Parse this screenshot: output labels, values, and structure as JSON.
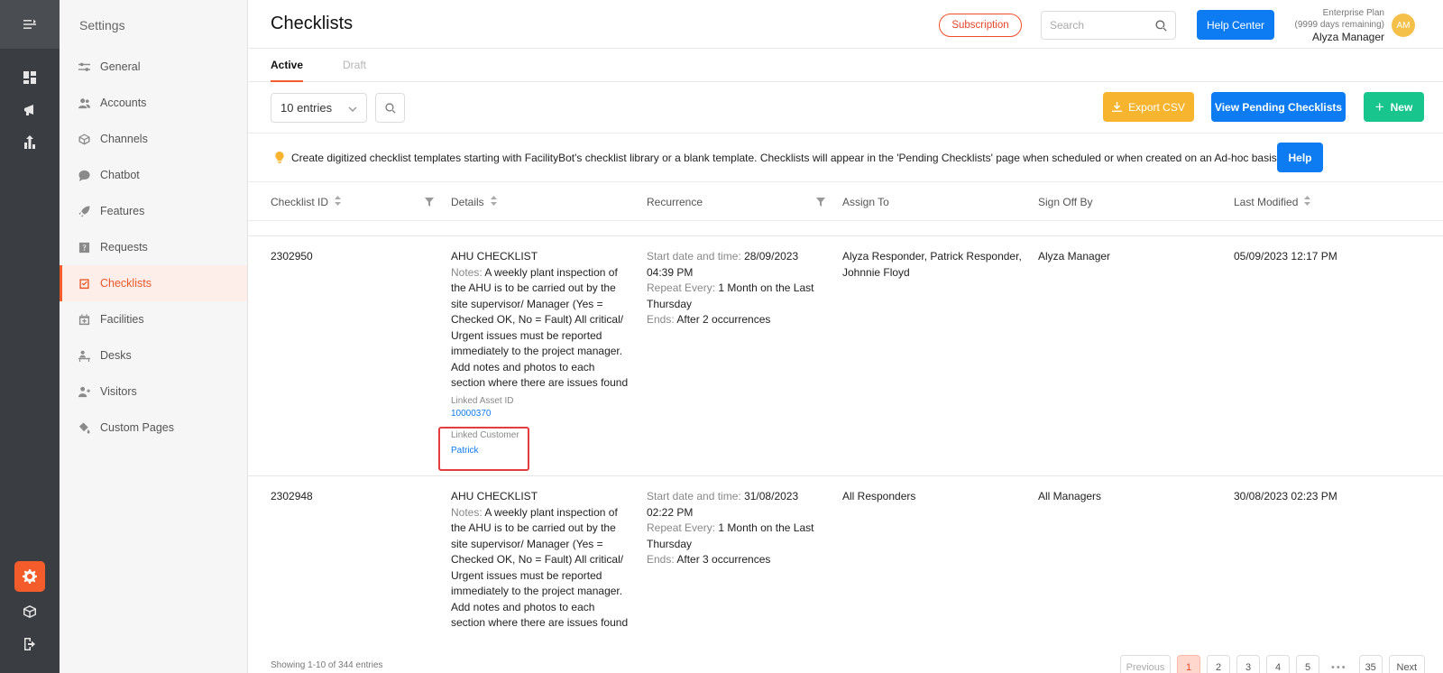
{
  "colors": {
    "accent": "#f45d2b",
    "primary": "#0d7cf2",
    "warning": "#f7b52f",
    "success": "#17c58d",
    "highlight": "#e33d3d"
  },
  "sidebar": {
    "title": "Settings",
    "items": [
      {
        "label": "General",
        "icon": "sliders-icon"
      },
      {
        "label": "Accounts",
        "icon": "users-icon"
      },
      {
        "label": "Channels",
        "icon": "cube-icon"
      },
      {
        "label": "Chatbot",
        "icon": "chat-icon"
      },
      {
        "label": "Features",
        "icon": "rocket-icon"
      },
      {
        "label": "Requests",
        "icon": "question-icon"
      },
      {
        "label": "Checklists",
        "icon": "checklist-icon"
      },
      {
        "label": "Facilities",
        "icon": "calendar-icon"
      },
      {
        "label": "Desks",
        "icon": "desk-icon"
      },
      {
        "label": "Visitors",
        "icon": "visitor-icon"
      },
      {
        "label": "Custom Pages",
        "icon": "paint-icon"
      }
    ]
  },
  "header": {
    "title": "Checklists",
    "subscription": "Subscription",
    "search_placeholder": "Search",
    "help_center": "Help Center",
    "plan_name": "Enterprise Plan",
    "plan_days": "(9999 days remaining)",
    "user_name": "Alyza Manager",
    "avatar_initials": "AM"
  },
  "tabs": {
    "active": "Active",
    "draft": "Draft"
  },
  "toolbar": {
    "entries": "10 entries",
    "export": "Export CSV",
    "pending": "View Pending Checklists",
    "new": "New"
  },
  "info": {
    "text": "Create digitized checklist templates starting with FacilityBot's checklist library or a blank template. Checklists will appear in the 'Pending Checklists' page when scheduled or when created on an Ad-hoc basis.",
    "help": "Help"
  },
  "table": {
    "columns": {
      "id": "Checklist ID",
      "details": "Details",
      "recurrence": "Recurrence",
      "assign": "Assign To",
      "signoff": "Sign Off By",
      "modified": "Last Modified"
    },
    "labels": {
      "notes": "Notes:",
      "start": "Start date and time:",
      "repeat": "Repeat Every:",
      "ends": "Ends:",
      "linked_asset": "Linked Asset ID",
      "linked_customer": "Linked Customer"
    },
    "rows": [
      {
        "id": "2302950",
        "title": "AHU CHECKLIST",
        "notes": "A weekly plant inspection of the AHU is to be carried out by the site supervisor/ Manager (Yes = Checked OK, No = Fault) All critical/ Urgent issues must be reported immediately to the project manager. Add notes and photos to each section where there are issues found",
        "linked_asset": "10000370",
        "linked_customer": "Patrick",
        "start": "28/09/2023 04:39 PM",
        "repeat": "1 Month on the Last Thursday",
        "ends": "After 2 occurrences",
        "assign": "Alyza Responder, Patrick Responder, Johnnie Floyd",
        "signoff": "Alyza Manager",
        "modified": "05/09/2023 12:17 PM"
      },
      {
        "id": "2302948",
        "title": "AHU CHECKLIST",
        "notes": "A weekly plant inspection of the AHU is to be carried out by the site supervisor/ Manager (Yes = Checked OK, No = Fault) All critical/ Urgent issues must be reported immediately to the project manager. Add notes and photos to each section where there are issues found",
        "start": "31/08/2023 02:22 PM",
        "repeat": "1 Month on the Last Thursday",
        "ends": "After 3 occurrences",
        "assign": "All Responders",
        "signoff": "All Managers",
        "modified": "30/08/2023 02:23 PM"
      }
    ]
  },
  "footer": {
    "showing": "Showing 1-10 of 344 entries",
    "previous": "Previous",
    "pages": [
      "1",
      "2",
      "3",
      "4",
      "5"
    ],
    "dots": "•••",
    "last": "35",
    "next": "Next"
  }
}
